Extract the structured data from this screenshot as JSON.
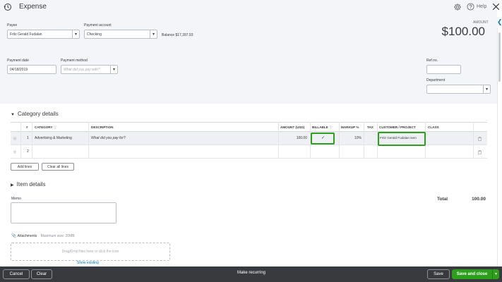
{
  "header": {
    "title": "Expense",
    "help_label": "Help",
    "amount_label": "AMOUNT",
    "amount_value": "$100.00"
  },
  "form": {
    "payee_label": "Payee",
    "payee_value": "Fritz Gerald Fudalan",
    "payment_account_label": "Payment account",
    "payment_account_value": "Checking",
    "balance_text": "Balance $17,397.93",
    "payment_date_label": "Payment date",
    "payment_date_value": "04/18/2019",
    "payment_method_label": "Payment method",
    "payment_method_placeholder": "What did you pay with?",
    "ref_no_label": "Ref no.",
    "ref_no_value": "",
    "department_label": "Department",
    "department_value": ""
  },
  "category_details": {
    "title": "Category details",
    "columns": {
      "num": "#",
      "category": "CATEGORY",
      "description": "DESCRIPTION",
      "amount": "AMOUNT (USD)",
      "billable": "BILLABLE",
      "markup": "MARKUP %",
      "tax": "TAX",
      "customer": "CUSTOMER / PROJECT",
      "class": "CLASS"
    },
    "rows": [
      {
        "num": "1",
        "category": "Advertising & Marketing",
        "description_placeholder": "What did you pay for?",
        "amount": "100.00",
        "billable": "✓",
        "markup": "10%",
        "tax": "",
        "customer": "Fritz Gerald Fudalan sem",
        "class": ""
      },
      {
        "num": "2",
        "category": "",
        "description_placeholder": "",
        "amount": "",
        "billable": "",
        "markup": "",
        "tax": "",
        "customer": "",
        "class": ""
      }
    ],
    "add_lines_label": "Add lines",
    "clear_all_lines_label": "Clear all lines"
  },
  "item_details": {
    "title": "Item details"
  },
  "totals": {
    "total_label": "Total",
    "total_value": "100.00"
  },
  "memo": {
    "label": "Memo",
    "value": ""
  },
  "attachments": {
    "label": "Attachments",
    "max_size": "Maximum size: 20MB",
    "drop_text": "Drag/Drop files here or click the icon",
    "show_existing": "Show existing"
  },
  "footer": {
    "cancel_label": "Cancel",
    "clear_label": "Clear",
    "make_recurring_label": "Make recurring",
    "save_label": "Save",
    "save_and_close_label": "Save and close"
  },
  "colors": {
    "accent_green": "#2ca01c",
    "link_blue": "#0077c5",
    "footer_bg": "#393a3d",
    "header_bg": "#f4f5f8"
  }
}
